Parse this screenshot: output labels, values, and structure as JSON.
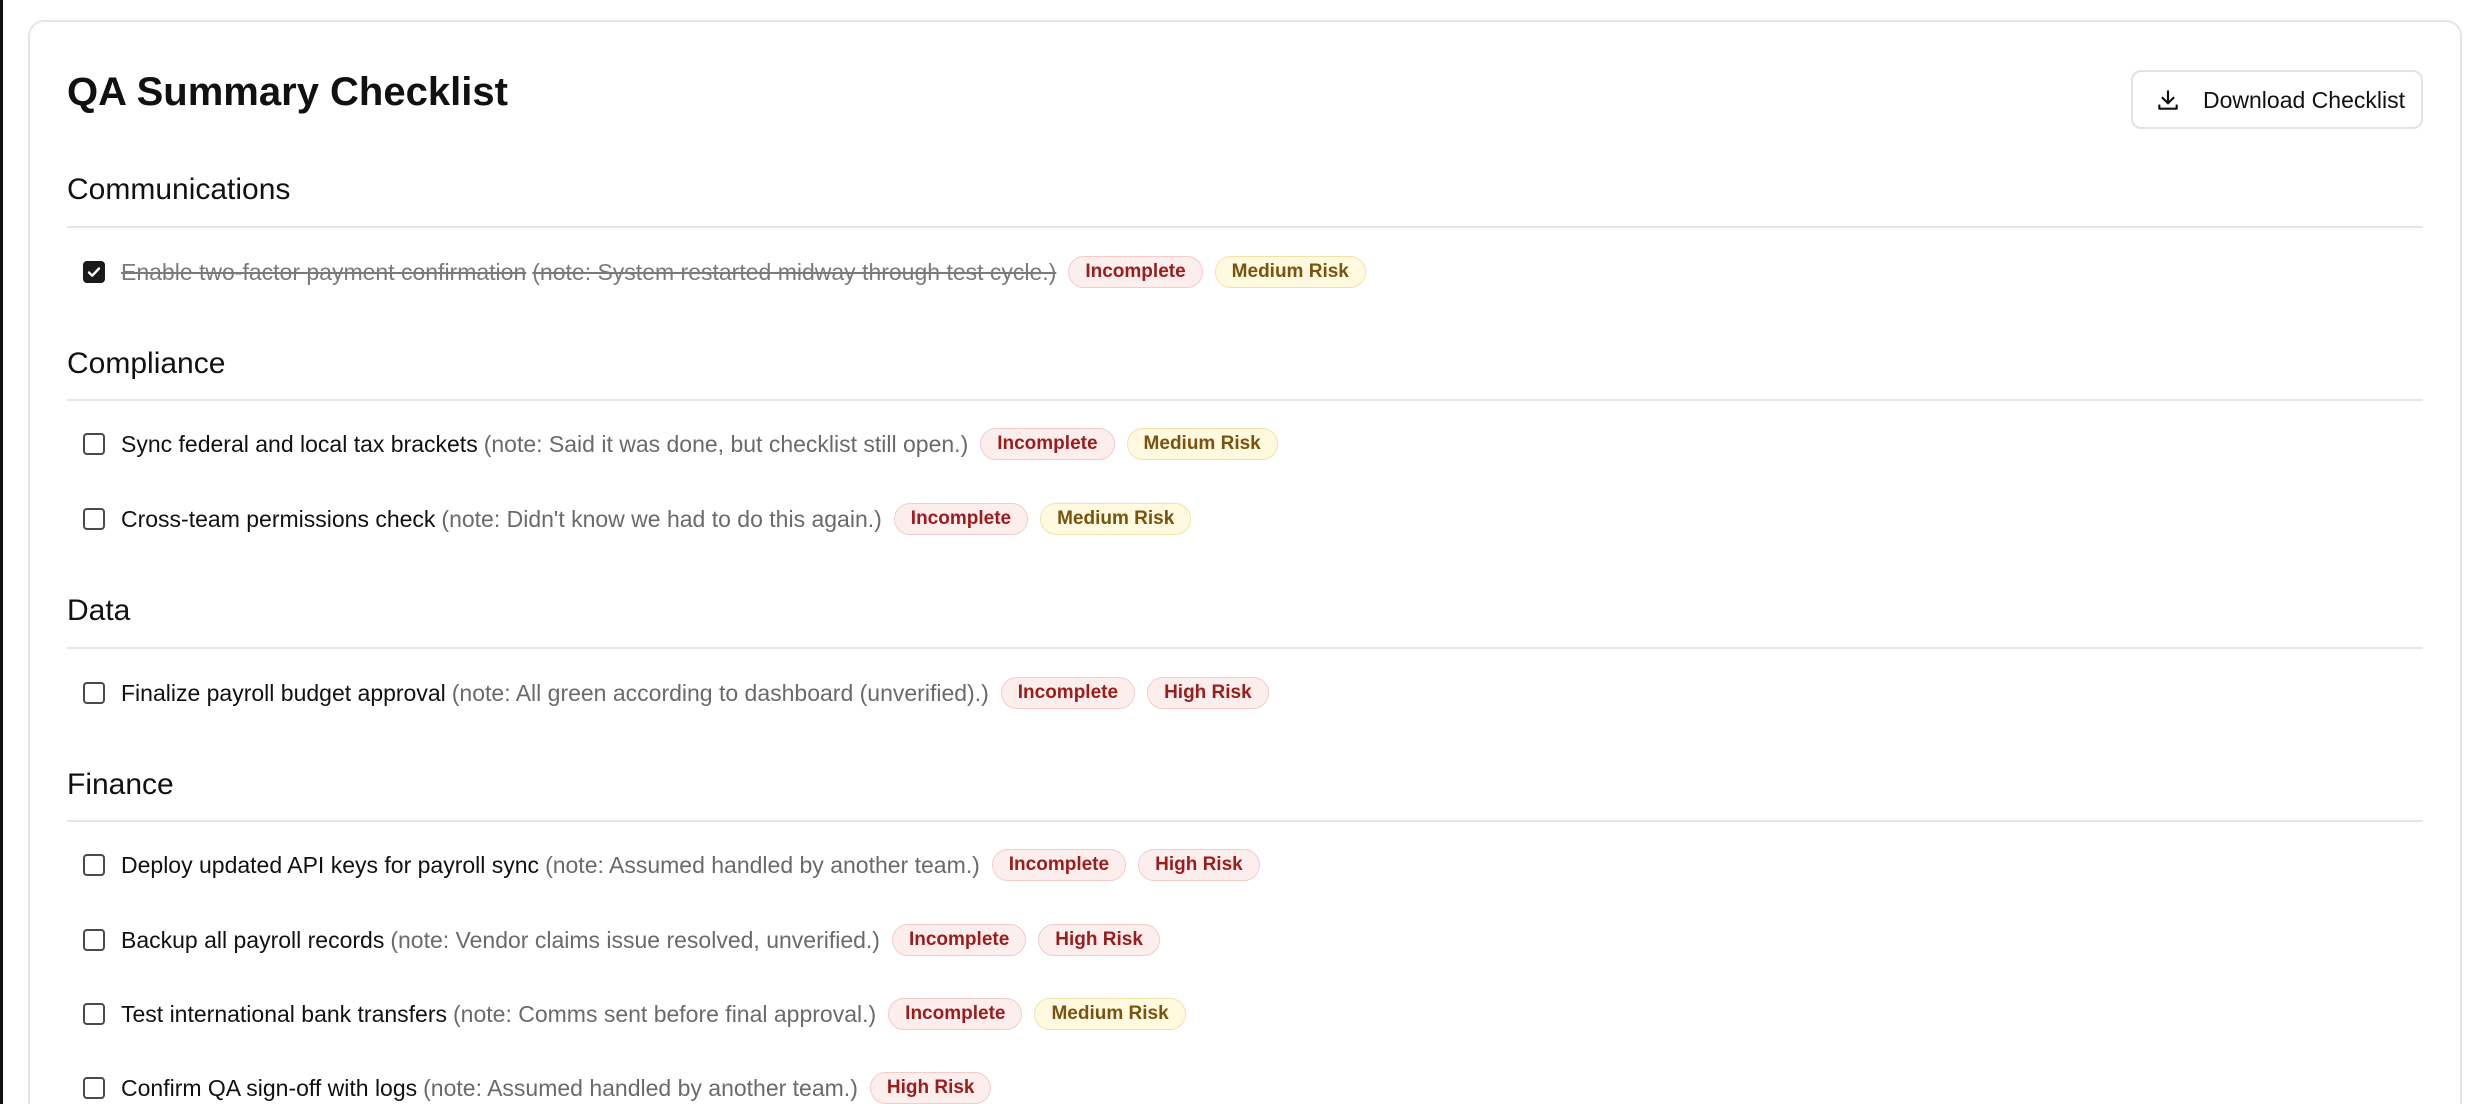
{
  "header": {
    "title": "QA Summary Checklist",
    "download_label": "Download Checklist"
  },
  "sections": [
    {
      "title": "Communications",
      "items": [
        {
          "label": "Enable two-factor payment confirmation",
          "note": "(note: System restarted midway through test cycle.)",
          "checked": true,
          "status": "Incomplete",
          "risk": "Medium Risk"
        }
      ]
    },
    {
      "title": "Compliance",
      "items": [
        {
          "label": "Sync federal and local tax brackets",
          "note": "(note: Said it was done, but checklist still open.)",
          "checked": false,
          "status": "Incomplete",
          "risk": "Medium Risk"
        },
        {
          "label": "Cross-team permissions check",
          "note": "(note: Didn't know we had to do this again.)",
          "checked": false,
          "status": "Incomplete",
          "risk": "Medium Risk"
        }
      ]
    },
    {
      "title": "Data",
      "items": [
        {
          "label": "Finalize payroll budget approval",
          "note": "(note: All green according to dashboard (unverified).)",
          "checked": false,
          "status": "Incomplete",
          "risk": "High Risk"
        }
      ]
    },
    {
      "title": "Finance",
      "items": [
        {
          "label": "Deploy updated API keys for payroll sync",
          "note": "(note: Assumed handled by another team.)",
          "checked": false,
          "status": "Incomplete",
          "risk": "High Risk"
        },
        {
          "label": "Backup all payroll records",
          "note": "(note: Vendor claims issue resolved, unverified.)",
          "checked": false,
          "status": "Incomplete",
          "risk": "High Risk"
        },
        {
          "label": "Test international bank transfers",
          "note": "(note: Comms sent before final approval.)",
          "checked": false,
          "status": "Incomplete",
          "risk": "Medium Risk"
        },
        {
          "label": "Confirm QA sign-off with logs",
          "note": "(note: Assumed handled by another team.)",
          "checked": false,
          "status": "",
          "risk": "High Risk"
        }
      ]
    }
  ],
  "colors": {
    "badge_incomplete_text": "#9b1c1c",
    "badge_incomplete_bg": "#fdeeee",
    "badge_medium_text": "#7a5310",
    "badge_medium_bg": "#fff9df",
    "badge_high_text": "#9b1c1c",
    "badge_high_bg": "#fdeeee",
    "checkbox_checked": "#1a1a1a"
  },
  "icons": {
    "download": "download-icon",
    "checkmark": "checkmark-icon"
  }
}
